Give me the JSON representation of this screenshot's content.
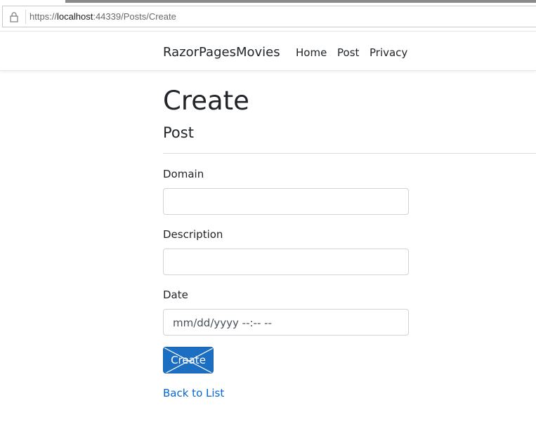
{
  "browser": {
    "url_prefix": "https://",
    "url_host": "localhost",
    "url_rest": ":44339/Posts/Create"
  },
  "navbar": {
    "brand": "RazorPagesMovies",
    "links": [
      "Home",
      "Post",
      "Privacy"
    ]
  },
  "page": {
    "title": "Create",
    "subtitle": "Post"
  },
  "form": {
    "fields": [
      {
        "label": "Domain",
        "value": ""
      },
      {
        "label": "Description",
        "value": ""
      },
      {
        "label": "Date",
        "value": "mm/dd/yyyy --:-- --"
      }
    ],
    "submit_label": "Create",
    "back_link": "Back to List"
  },
  "colors": {
    "primary": "#1b6ec2",
    "link": "#0366d6"
  }
}
